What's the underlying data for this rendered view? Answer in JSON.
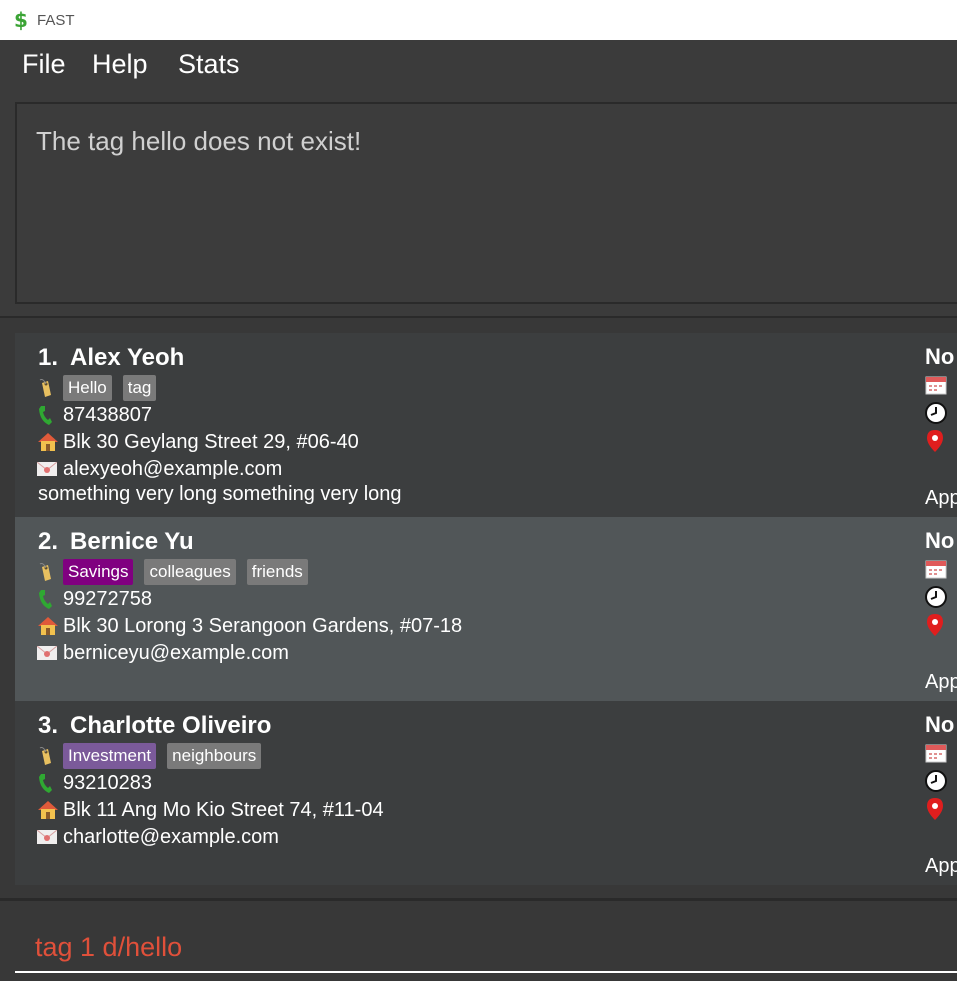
{
  "window": {
    "title": "FAST",
    "icon": "dollar-icon"
  },
  "menu": {
    "file": "File",
    "help": "Help",
    "stats": "Stats"
  },
  "result": {
    "message": "The tag hello does not exist!"
  },
  "persons": [
    {
      "index": "1.",
      "name": "Alex Yeoh",
      "tags": [
        {
          "label": "Hello",
          "color": "#7a7a7a"
        },
        {
          "label": "tag",
          "color": "#7a7a7a"
        }
      ],
      "phone": "87438807",
      "address": "Blk 30 Geylang Street 29, #06-40",
      "email": "alexyeoh@example.com",
      "remark": "something very long something very long",
      "appointment_title": "No",
      "appointment_label": "App"
    },
    {
      "index": "2.",
      "name": "Bernice Yu",
      "tags": [
        {
          "label": "Savings",
          "color": "#800080"
        },
        {
          "label": "colleagues",
          "color": "#7a7a7a"
        },
        {
          "label": "friends",
          "color": "#7a7a7a"
        }
      ],
      "phone": "99272758",
      "address": "Blk 30 Lorong 3 Serangoon Gardens, #07-18",
      "email": "berniceyu@example.com",
      "remark": "",
      "appointment_title": "No",
      "appointment_label": "App"
    },
    {
      "index": "3.",
      "name": "Charlotte Oliveiro",
      "tags": [
        {
          "label": "Investment",
          "color": "#7b5a9a"
        },
        {
          "label": "neighbours",
          "color": "#7a7a7a"
        }
      ],
      "phone": "93210283",
      "address": "Blk 11 Ang Mo Kio Street 74, #11-04",
      "email": "charlotte@example.com",
      "remark": "",
      "appointment_title": "No",
      "appointment_label": "App"
    }
  ],
  "command": {
    "value": "tag 1 d/hello"
  },
  "colors": {
    "command_error": "#e0503a",
    "background": "#383838",
    "card_alt": "#515658"
  }
}
